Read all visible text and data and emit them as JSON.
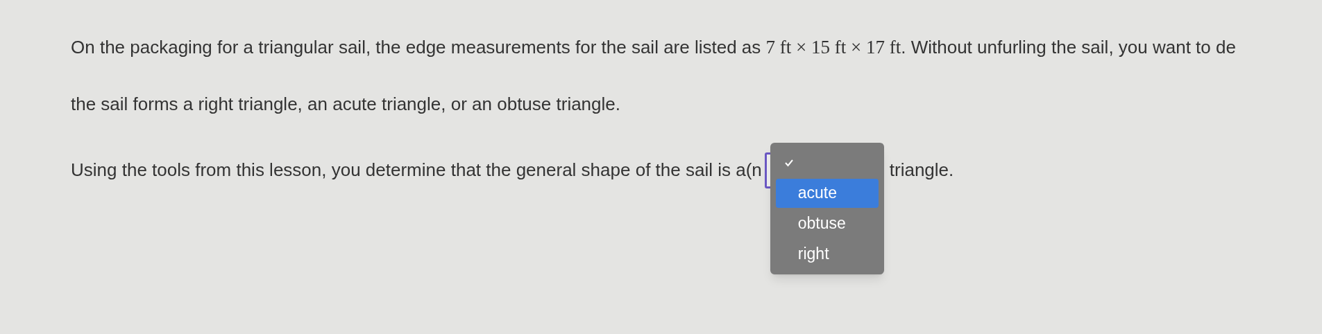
{
  "question": {
    "lines": [
      [
        {
          "kind": "text",
          "text": "On the packaging for a triangular sail, the edge measurements for the sail are listed as "
        },
        {
          "kind": "math",
          "text": "7 ft × 15 ft × 17 ft"
        },
        {
          "kind": "text",
          "text": ". Without unfurling the sail, you want to de"
        }
      ],
      [
        {
          "kind": "text",
          "text": "the sail forms a right triangle, an acute triangle, or an obtuse triangle."
        }
      ]
    ]
  },
  "answer": {
    "before": "Using the tools from this lesson, you determine that the general shape of the sail is a(n",
    "after": "triangle.",
    "menu": [
      {
        "checked": true,
        "highlighted": false
      },
      {
        "label": "acute",
        "checked": false,
        "highlighted": true
      },
      {
        "label": "obtuse",
        "checked": false,
        "highlighted": false
      },
      {
        "label": "right",
        "checked": false,
        "highlighted": false
      }
    ]
  }
}
